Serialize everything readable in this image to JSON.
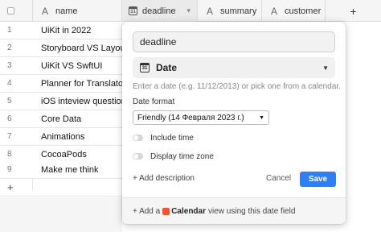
{
  "header": {
    "name": "name",
    "deadline": "deadline",
    "summary": "summary",
    "customer": "customer",
    "add_column": "+"
  },
  "rows": [
    {
      "num": "1",
      "name": "UiKit in 2022"
    },
    {
      "num": "2",
      "name": "Storyboard VS Layout"
    },
    {
      "num": "3",
      "name": "UiKit VS SwftUI"
    },
    {
      "num": "4",
      "name": "Planner for Translator"
    },
    {
      "num": "5",
      "name": "iOS inteview questions"
    },
    {
      "num": "6",
      "name": "Core Data"
    },
    {
      "num": "7",
      "name": "Animations"
    },
    {
      "num": "8",
      "name": "CocoaPods"
    },
    {
      "num": "9",
      "name": "Make me think"
    }
  ],
  "add_row": "+",
  "popover": {
    "field_name": "deadline",
    "type_label": "Date",
    "help": "Enter a date (e.g. 11/12/2013) or pick one from a calendar.",
    "format_label": "Date format",
    "format_value": "Friendly (14 Февраля 2023 г.)",
    "include_time": "Include time",
    "display_time_zone": "Display time zone",
    "add_description": "+ Add description",
    "cancel": "Cancel",
    "save": "Save",
    "footer_prefix": "+ Add a",
    "footer_app": "Calendar",
    "footer_suffix": "view using this date field"
  },
  "icons": {
    "text_field": "A",
    "calendar": "31"
  },
  "colors": {
    "primary": "#2d7ff9",
    "calendar_badge": "#f0562d"
  }
}
